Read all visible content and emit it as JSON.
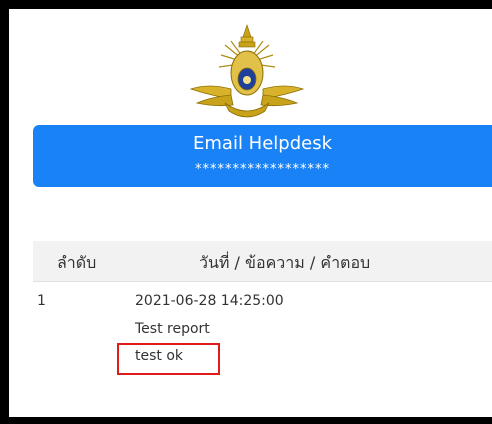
{
  "header": {
    "title": "Email Helpdesk",
    "email_masked": "******************"
  },
  "table": {
    "columns": [
      "ลำดับ",
      "วันที่ / ข้อความ / คำตอบ"
    ],
    "rows": [
      {
        "index": "1",
        "datetime": "2021-06-28 14:25:00",
        "message": "Test report",
        "reply": "test ok"
      }
    ]
  },
  "colors": {
    "banner": "#1a82f7",
    "highlight": "#e01b1b",
    "emblem_gold": "#c9a21b"
  },
  "icons": {
    "emblem": "royal-thai-army-emblem-icon"
  }
}
